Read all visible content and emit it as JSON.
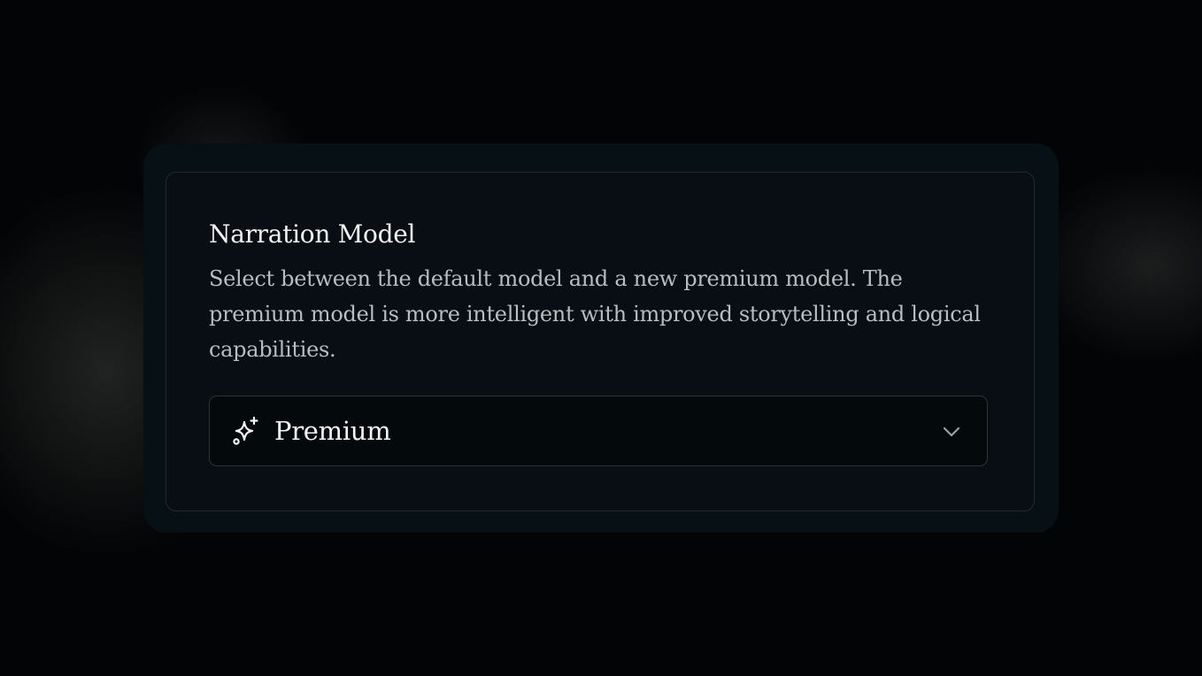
{
  "setting": {
    "title": "Narration Model",
    "description": "Select between the default model and a new premium model. The premium model is more intelligent with improved storytelling and logical capabilities."
  },
  "model_select": {
    "selected_value": "Premium",
    "leading_icon": "sparkles-icon",
    "trailing_icon": "chevron-down-icon"
  },
  "colors": {
    "background": "#020405",
    "card": "#071015",
    "inner_card": "#080e13",
    "title_text": "#f2f2f0",
    "description_text": "#b9bdc0",
    "select_border": "#2c3336"
  }
}
